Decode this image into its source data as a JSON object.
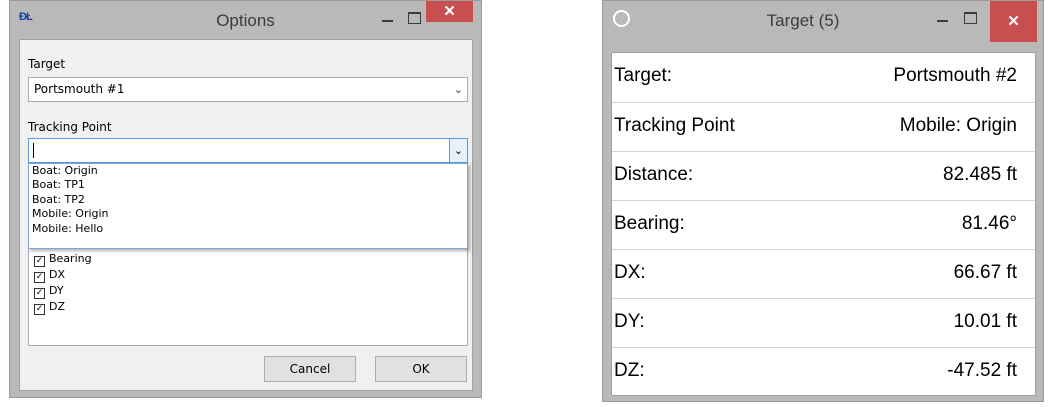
{
  "options_window": {
    "app_icon_text": "ĐŁ",
    "title": "Options",
    "target_label": "Target",
    "target_value": "Portsmouth #1",
    "tracking_label": "Tracking Point",
    "tracking_value": "",
    "dropdown_items": [
      "Boat: Origin",
      "Boat: TP1",
      "Boat: TP2",
      "Mobile: Origin",
      "Mobile: Hello"
    ],
    "checkbox_items": [
      {
        "label": "Bearing",
        "checked": true
      },
      {
        "label": "DX",
        "checked": true
      },
      {
        "label": "DY",
        "checked": true
      },
      {
        "label": "DZ",
        "checked": true
      }
    ],
    "cancel_label": "Cancel",
    "ok_label": "OK",
    "close_glyph": "✕",
    "arrow_glyph": "⌄",
    "check_glyph": "✓"
  },
  "target_window": {
    "title": "Target (5)",
    "close_glyph": "✕",
    "rows": [
      {
        "key": "Target:",
        "value": "Portsmouth #2"
      },
      {
        "key": "Tracking Point",
        "value": "Mobile: Origin"
      },
      {
        "key": "Distance:",
        "value": "82.485 ft"
      },
      {
        "key": "Bearing:",
        "value": "81.46°"
      },
      {
        "key": "DX:",
        "value": "66.67 ft"
      },
      {
        "key": "DY:",
        "value": "10.01 ft"
      },
      {
        "key": "DZ:",
        "value": "-47.52 ft"
      }
    ]
  },
  "colors": {
    "close_button": "#c74f4f",
    "window_frame": "#b9b9b9",
    "focus_border": "#569de5"
  }
}
